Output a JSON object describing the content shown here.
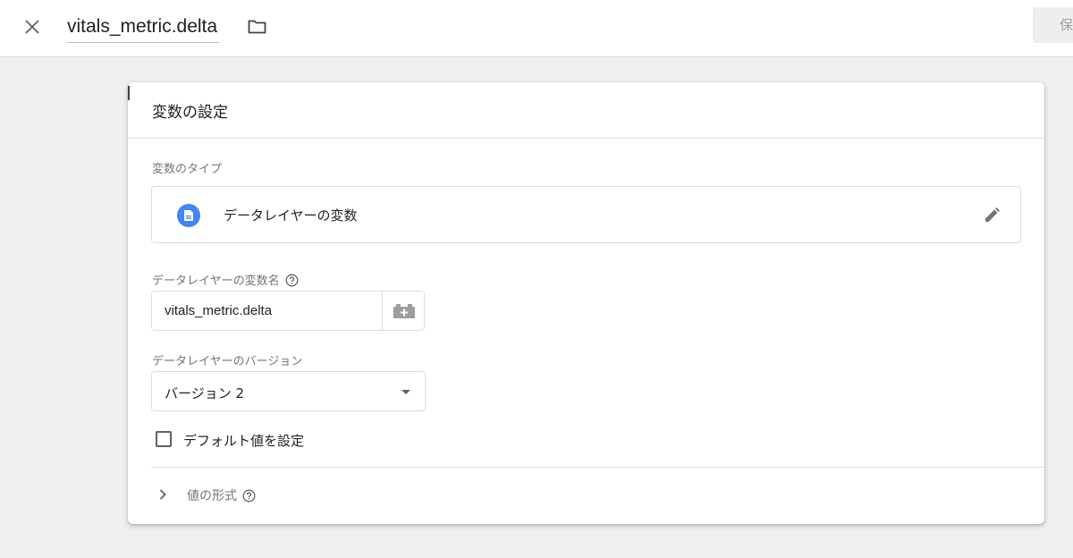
{
  "topbar": {
    "close_icon": "close-icon",
    "title": "vitals_metric.delta",
    "folder_icon": "folder-icon",
    "save_label": "保"
  },
  "card": {
    "title": "変数の設定",
    "type_section": {
      "label": "変数のタイプ",
      "type_name": "データレイヤーの変数",
      "type_icon": "document-icon",
      "edit_icon": "pencil-icon"
    },
    "name_field": {
      "label": "データレイヤーの変数名",
      "help_icon": "help-circle-icon",
      "value": "vitals_metric.delta",
      "picker_icon": "variable-picker-icon"
    },
    "version_field": {
      "label": "データレイヤーのバージョン",
      "selected": "バージョン 2"
    },
    "default_checkbox": {
      "label": "デフォルト値を設定",
      "checked": false
    },
    "format_section": {
      "label": "値の形式",
      "expanded": false
    }
  },
  "colors": {
    "accent": "#4285f4",
    "background": "#efefef"
  }
}
